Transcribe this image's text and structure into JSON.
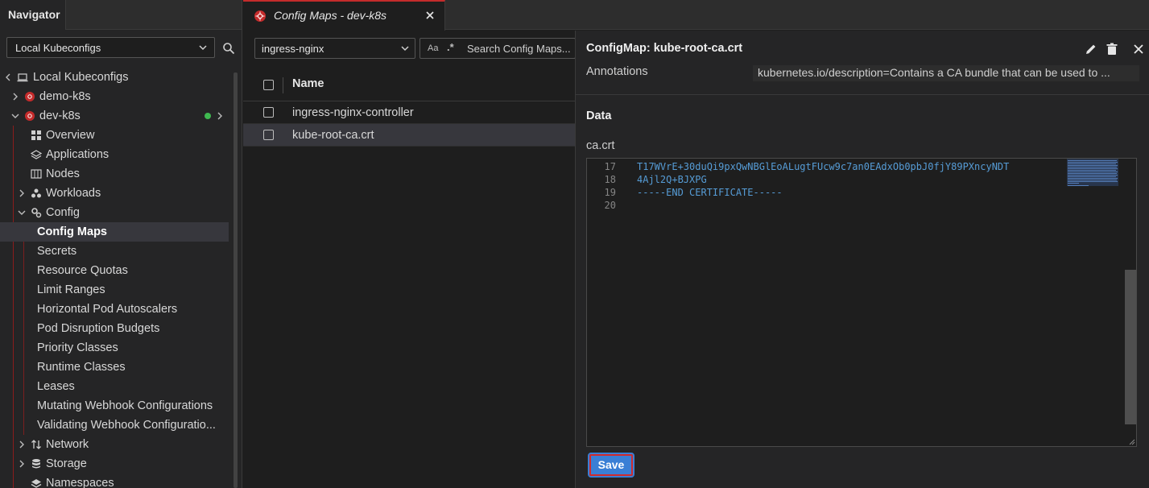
{
  "navigator": {
    "tab_title": "Navigator",
    "context_select": "Local Kubeconfigs",
    "tree": {
      "root": "Local Kubeconfigs",
      "clusters": [
        "demo-k8s",
        "dev-k8s"
      ],
      "items": {
        "overview": "Overview",
        "applications": "Applications",
        "nodes": "Nodes",
        "workloads": "Workloads",
        "config": "Config",
        "config_maps": "Config Maps",
        "secrets": "Secrets",
        "resource_quotas": "Resource Quotas",
        "limit_ranges": "Limit Ranges",
        "hpa": "Horizontal Pod Autoscalers",
        "pdb": "Pod Disruption Budgets",
        "priority_classes": "Priority Classes",
        "runtime_classes": "Runtime Classes",
        "leases": "Leases",
        "mutating_webhooks": "Mutating Webhook Configurations",
        "validating_webhooks": "Validating Webhook Configuratio...",
        "network": "Network",
        "storage": "Storage",
        "namespaces": "Namespaces"
      }
    }
  },
  "tab": {
    "title": "Config Maps - dev-k8s"
  },
  "list": {
    "namespace_select": "ingress-nginx",
    "search": {
      "case_label": "Aa",
      "regex_label": ".*",
      "placeholder": "Search Config Maps..."
    },
    "column_name": "Name",
    "rows": [
      "ingress-nginx-controller",
      "kube-root-ca.crt"
    ]
  },
  "detail": {
    "title": "ConfigMap: kube-root-ca.crt",
    "annotations_label": "Annotations",
    "annotations_value": "kubernetes.io/description=Contains a CA bundle that can be used to ...",
    "data_heading": "Data",
    "key_label": "ca.crt",
    "editor_lines": [
      {
        "num": "17",
        "text": "T17WVrE+30duQi9pxQwNBGlEoALugtFUcw9c7an0EAdxOb0pbJ0fjY89PXncyNDT"
      },
      {
        "num": "18",
        "text": "4Ajl2Q+BJXPG"
      },
      {
        "num": "19",
        "text": "-----END CERTIFICATE-----"
      },
      {
        "num": "20",
        "text": ""
      }
    ],
    "save_label": "Save"
  },
  "colors": {
    "accent_red": "#c42b2b",
    "status_green": "#3fb950",
    "save_blue": "#3a7fd5",
    "code_blue": "#569cd6"
  }
}
